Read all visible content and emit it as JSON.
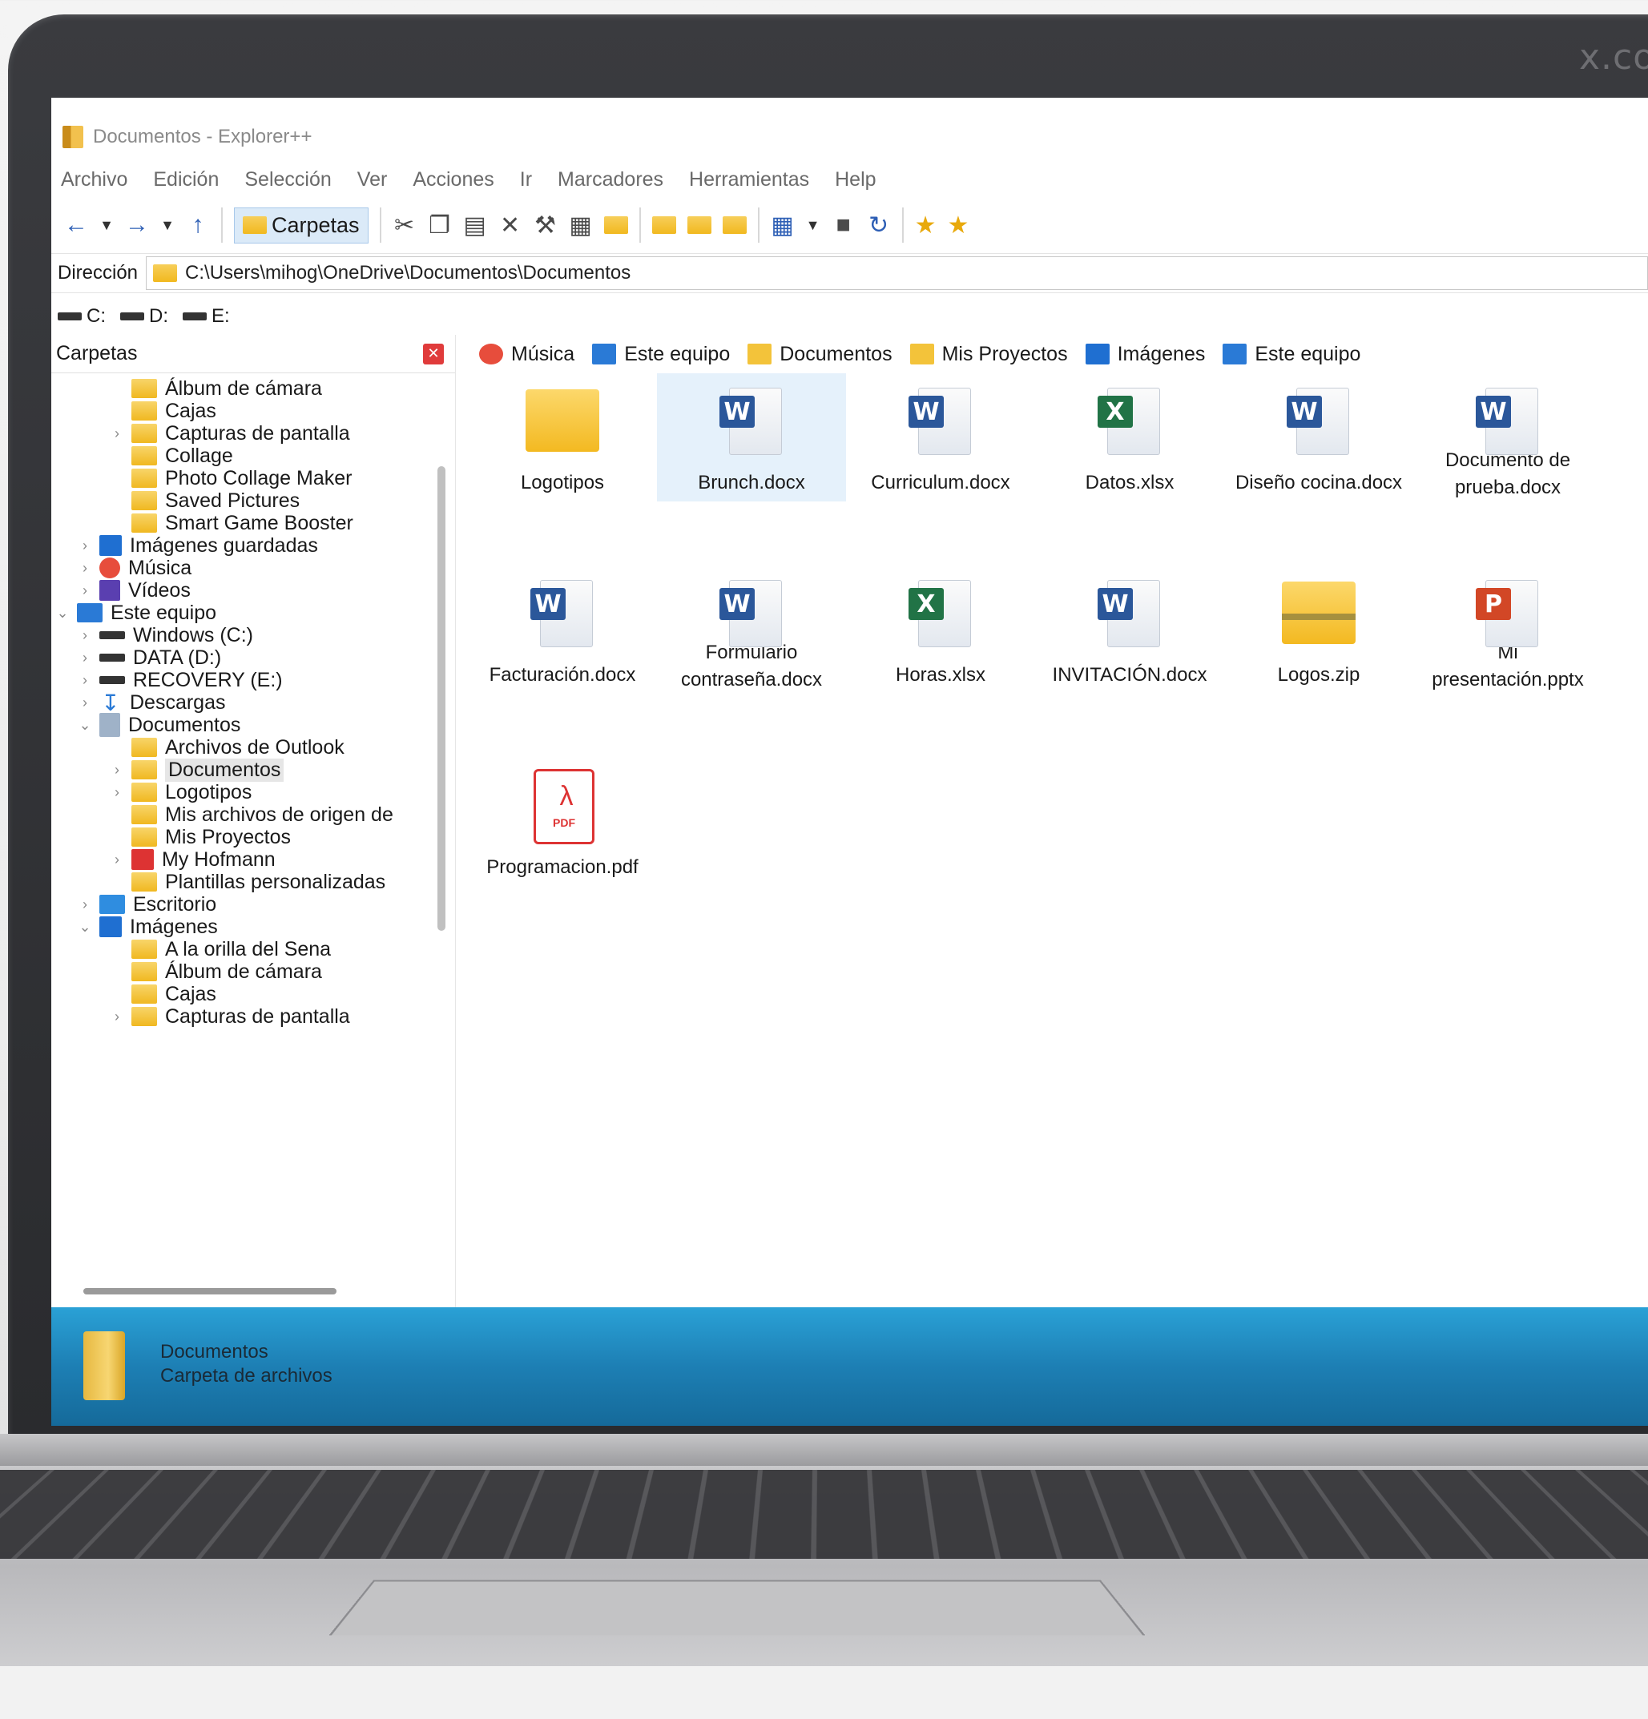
{
  "bezel_mark": "x.com",
  "window": {
    "title": "Documentos - Explorer++"
  },
  "menu": [
    "Archivo",
    "Edición",
    "Selección",
    "Ver",
    "Acciones",
    "Ir",
    "Marcadores",
    "Herramientas",
    "Help"
  ],
  "toolbar": {
    "carpetas_label": "Carpetas"
  },
  "address": {
    "label": "Dirección",
    "path": "C:\\Users\\mihog\\OneDrive\\Documentos\\Documentos"
  },
  "drives": [
    "C:",
    "D:",
    "E:"
  ],
  "tree": {
    "header": "Carpetas",
    "items": [
      {
        "label": "Álbum de cámara",
        "icon": "folder-icon"
      },
      {
        "label": "Cajas",
        "icon": "folder-icon"
      },
      {
        "label": "Capturas de pantalla",
        "icon": "folder-icon"
      },
      {
        "label": "Collage",
        "icon": "folder-icon"
      },
      {
        "label": "Photo Collage Maker",
        "icon": "folder-icon"
      },
      {
        "label": "Saved Pictures",
        "icon": "folder-icon"
      },
      {
        "label": "Smart Game Booster",
        "icon": "folder-icon"
      },
      {
        "label": "Imágenes guardadas",
        "icon": "pictures-icon"
      },
      {
        "label": "Música",
        "icon": "music-icon"
      },
      {
        "label": "Vídeos",
        "icon": "videos-icon"
      },
      {
        "label": "Este equipo",
        "icon": "computer-icon"
      },
      {
        "label": "Windows (C:)",
        "icon": "drive-icon"
      },
      {
        "label": "DATA (D:)",
        "icon": "drive-icon"
      },
      {
        "label": "RECOVERY (E:)",
        "icon": "drive-icon"
      },
      {
        "label": "Descargas",
        "icon": "download-icon"
      },
      {
        "label": "Documentos",
        "icon": "documents-icon"
      },
      {
        "label": "Archivos de Outlook",
        "icon": "folder-icon"
      },
      {
        "label": "Documentos",
        "icon": "folder-icon"
      },
      {
        "label": "Logotipos",
        "icon": "folder-icon"
      },
      {
        "label": "Mis archivos de origen de",
        "icon": "source-folder-icon"
      },
      {
        "label": "Mis Proyectos",
        "icon": "folder-icon"
      },
      {
        "label": "My Hofmann",
        "icon": "hofmann-icon"
      },
      {
        "label": "Plantillas personalizadas",
        "icon": "folder-icon"
      },
      {
        "label": "Escritorio",
        "icon": "desktop-icon"
      },
      {
        "label": "Imágenes",
        "icon": "pictures-icon"
      },
      {
        "label": "A la orilla del Sena",
        "icon": "folder-icon"
      },
      {
        "label": "Álbum de cámara",
        "icon": "folder-icon"
      },
      {
        "label": "Cajas",
        "icon": "folder-icon"
      },
      {
        "label": "Capturas de pantalla",
        "icon": "folder-icon"
      }
    ]
  },
  "tabs": [
    {
      "label": "Música",
      "icon": "music-icon"
    },
    {
      "label": "Este equipo",
      "icon": "computer-icon"
    },
    {
      "label": "Documentos",
      "icon": "folder-icon"
    },
    {
      "label": "Mis Proyectos",
      "icon": "folder-icon"
    },
    {
      "label": "Imágenes",
      "icon": "pictures-icon"
    },
    {
      "label": "Este equipo",
      "icon": "computer-icon"
    }
  ],
  "files": [
    {
      "name": "Logotipos",
      "type": "folder"
    },
    {
      "name": "Brunch.docx",
      "type": "word"
    },
    {
      "name": "Curriculum.docx",
      "type": "word"
    },
    {
      "name": "Datos.xlsx",
      "type": "excel"
    },
    {
      "name": "Diseño cocina.docx",
      "type": "word"
    },
    {
      "name": "Documento de\nprueba.docx",
      "type": "word"
    },
    {
      "name": "Facturación.docx",
      "type": "word"
    },
    {
      "name": "Formulario\ncontraseña.docx",
      "type": "word"
    },
    {
      "name": "Horas.xlsx",
      "type": "excel"
    },
    {
      "name": "INVITACIÓN.docx",
      "type": "word"
    },
    {
      "name": "Logos.zip",
      "type": "zip"
    },
    {
      "name": "Mi\npresentación.pptx",
      "type": "powerpoint"
    },
    {
      "name": "Programacion.pdf",
      "type": "pdf"
    }
  ],
  "badges": {
    "word": "W",
    "excel": "X",
    "powerpoint": "P",
    "pdf_text": "PDF"
  },
  "details": {
    "name": "Documentos",
    "type": "Carpeta de archivos"
  },
  "colors": {
    "word": "#2b579a",
    "excel": "#217346",
    "powerpoint": "#d24726",
    "pdf": "#dd3333",
    "details_bar": "#1d7fb4"
  }
}
